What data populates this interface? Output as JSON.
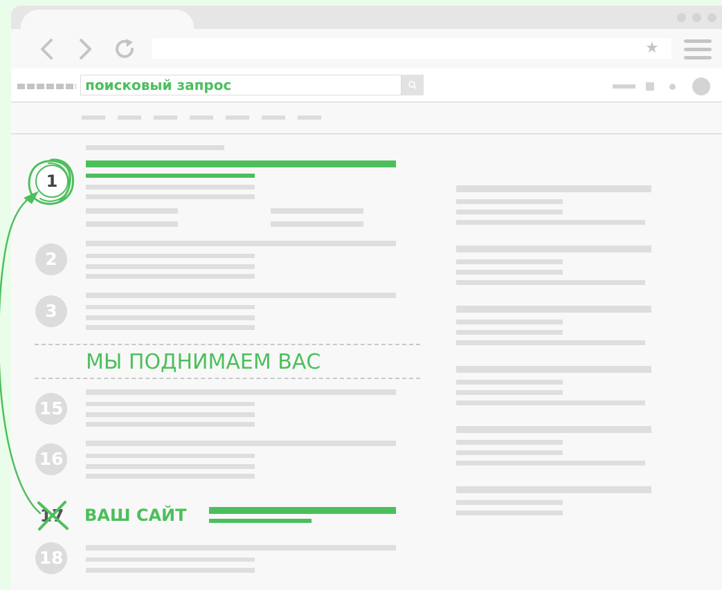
{
  "search": {
    "query": "поисковый запрос"
  },
  "browser": {
    "back_icon": "chevron-left-icon",
    "forward_icon": "chevron-right-icon",
    "reload_icon": "reload-icon",
    "star_icon": "star-icon",
    "menu_icon": "hamburger-icon",
    "star_glyph": "★"
  },
  "results": {
    "ranks": [
      "1",
      "2",
      "3",
      "15",
      "16",
      "17",
      "18"
    ]
  },
  "banner": {
    "text": "МЫ ПОДНИМАЕМ ВАС"
  },
  "your_site": {
    "label": "ВАШ САЙТ"
  },
  "colors": {
    "accent": "#4cbf5c",
    "background": "#eafdea",
    "placeholder": "#dedede"
  }
}
